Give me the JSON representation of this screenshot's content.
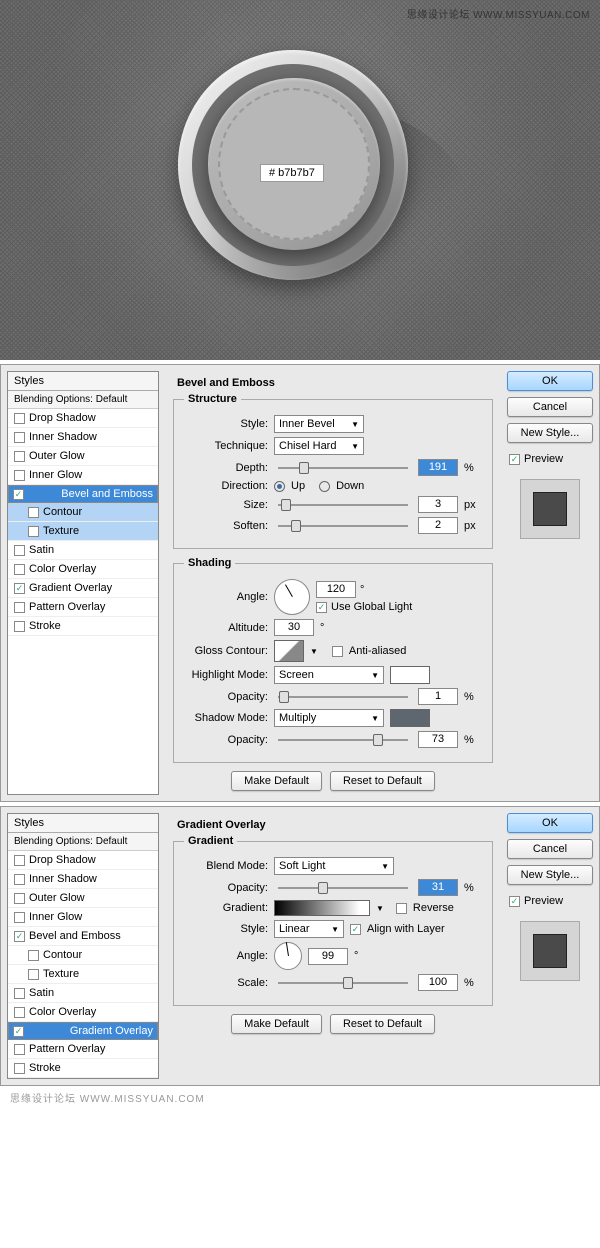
{
  "watermark": "思缘设计论坛 WWW.MISSYUAN.COM",
  "footer_watermark": "思缘设计论坛 WWW.MISSYUAN.COM",
  "hex": "#  b7b7b7",
  "styles_header": "Styles",
  "blending_header": "Blending Options: Default",
  "style_list": {
    "drop_shadow": "Drop Shadow",
    "inner_shadow": "Inner Shadow",
    "outer_glow": "Outer Glow",
    "inner_glow": "Inner Glow",
    "bevel": "Bevel and Emboss",
    "contour": "Contour",
    "texture": "Texture",
    "satin": "Satin",
    "color_overlay": "Color Overlay",
    "gradient_overlay": "Gradient Overlay",
    "pattern_overlay": "Pattern Overlay",
    "stroke": "Stroke"
  },
  "panel1": {
    "legend_main": "Bevel and Emboss",
    "legend_structure": "Structure",
    "labels": {
      "style": "Style:",
      "technique": "Technique:",
      "depth": "Depth:",
      "direction": "Direction:",
      "up": "Up",
      "down": "Down",
      "size": "Size:",
      "soften": "Soften:"
    },
    "values": {
      "style": "Inner Bevel",
      "technique": "Chisel Hard",
      "depth": "191",
      "size": "3",
      "soften": "2"
    },
    "units": {
      "pct": "%",
      "px": "px"
    },
    "legend_shading": "Shading",
    "shading_labels": {
      "angle": "Angle:",
      "altitude": "Altitude:",
      "use_global": "Use Global Light",
      "gloss": "Gloss Contour:",
      "anti": "Anti-aliased",
      "highlight": "Highlight Mode:",
      "opacity": "Opacity:",
      "shadow": "Shadow Mode:"
    },
    "shading_values": {
      "angle": "120",
      "altitude": "30",
      "highlight_mode": "Screen",
      "highlight_op": "1",
      "shadow_mode": "Multiply",
      "shadow_op": "73",
      "shadow_color": "#5e6670"
    },
    "deg": "°"
  },
  "panel2": {
    "legend_main": "Gradient Overlay",
    "legend_gradient": "Gradient",
    "labels": {
      "blend": "Blend Mode:",
      "opacity": "Opacity:",
      "gradient": "Gradient:",
      "reverse": "Reverse",
      "style": "Style:",
      "align": "Align with Layer",
      "angle": "Angle:",
      "scale": "Scale:"
    },
    "values": {
      "blend": "Soft Light",
      "opacity": "31",
      "style": "Linear",
      "angle": "99",
      "scale": "100"
    },
    "units": {
      "pct": "%",
      "deg": "°"
    }
  },
  "buttons": {
    "ok": "OK",
    "cancel": "Cancel",
    "new_style": "New Style...",
    "preview": "Preview",
    "make_default": "Make Default",
    "reset": "Reset to Default"
  }
}
